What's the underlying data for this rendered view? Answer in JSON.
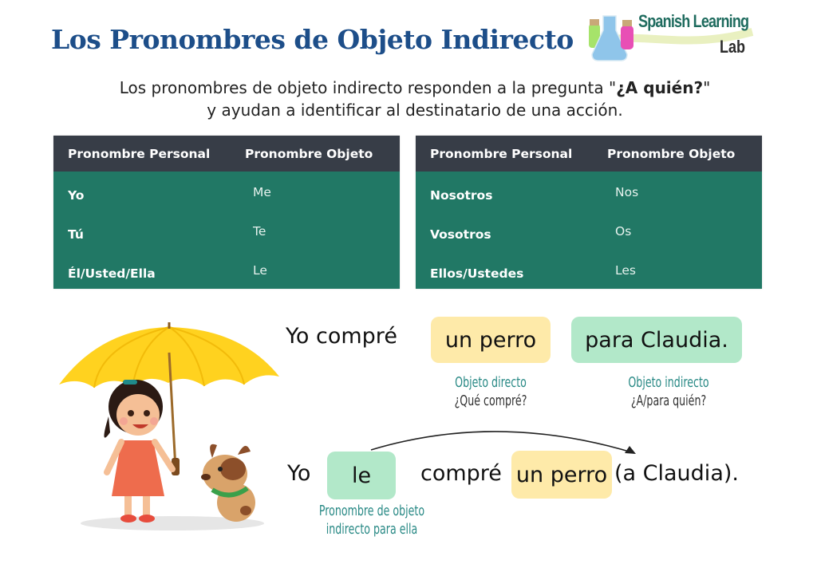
{
  "header": {
    "title": "Los Pronombres de Objeto Indirecto",
    "logo": {
      "line1": "Spanish Learning",
      "line2": "Lab",
      "icon": "flask-icon"
    }
  },
  "intro": {
    "line1_before": "Los pronombres de objeto indirecto responden a la pregunta \"",
    "line1_bold": "¿A quién?",
    "line1_after": "\"",
    "line2": "y ayudan a identificar al destinatario de una acción."
  },
  "tables": [
    {
      "headers": [
        "Pronombre Personal",
        "Pronombre Objeto"
      ],
      "rows": [
        [
          "Yo",
          "Me"
        ],
        [
          "Tú",
          "Te"
        ],
        [
          "Él/Usted/Ella",
          "Le"
        ]
      ]
    },
    {
      "headers": [
        "Pronombre Personal",
        "Pronombre Objeto"
      ],
      "rows": [
        [
          "Nosotros",
          "Nos"
        ],
        [
          "Vosotros",
          "Os"
        ],
        [
          "Ellos/Ustedes",
          "Les"
        ]
      ]
    }
  ],
  "example1": {
    "subject_verb": "Yo compré",
    "direct_object": "un perro",
    "indirect_object": "para Claudia.",
    "direct_caption": {
      "label": "Objeto directo",
      "question": "¿Qué compré?"
    },
    "indirect_caption": {
      "label": "Objeto indirecto",
      "question": "¿A/para quién?"
    }
  },
  "example2": {
    "subject": "Yo",
    "pronoun": "le",
    "verb": "compré",
    "direct_object": "un perro",
    "rest": "(a Claudia).",
    "pronoun_caption_line1": "Pronombre de objeto",
    "pronoun_caption_line2": "indirecto para ella"
  },
  "colors": {
    "title": "#1d4e89",
    "table_header": "#373d47",
    "table_body": "#217865",
    "direct_highlight": "#feeaa9",
    "indirect_highlight": "#b2e8c9",
    "caption_teal": "#2a8a86"
  }
}
